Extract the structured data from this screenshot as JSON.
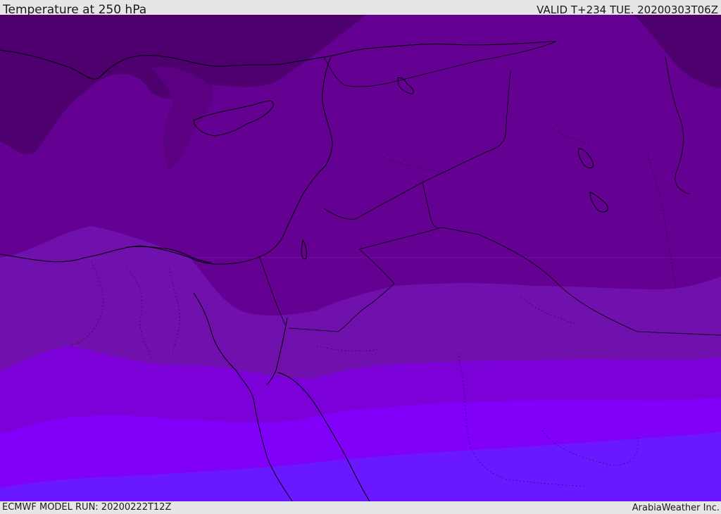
{
  "header": {
    "title": "Temperature at 250 hPa",
    "valid": "VALID T+234 TUE. 20200303T06Z"
  },
  "footer": {
    "model_run": "ECMWF MODEL RUN: 20200222T12Z",
    "brand": "ArabiaWeather Inc."
  },
  "colors": {
    "band_coldest": "#4e006e",
    "band_cold": "#5c0082",
    "band_mid": "#640092",
    "band_warm": "#7010ad",
    "band_warmer": "#7c00d8",
    "band_hot": "#8000fa",
    "band_hottest": "#6a18ff",
    "coastline": "#000000"
  }
}
